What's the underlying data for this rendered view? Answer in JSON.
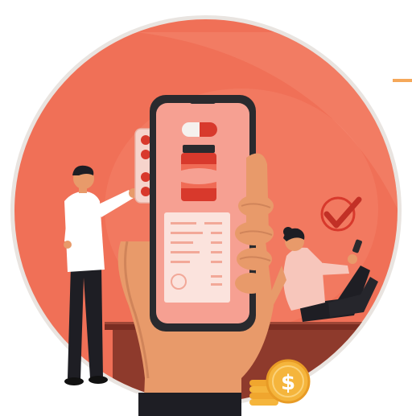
{
  "illustration": {
    "theme": "online pharmacy / mobile medicine ordering",
    "coin_symbol": "$",
    "colors": {
      "background_circle": "#f07057",
      "circle_border": "#ffffff",
      "phone_frame": "#2a2a2e",
      "phone_screen": "#f6a092",
      "pill_red": "#d8392c",
      "skin": "#e89a6a",
      "coin_gold": "#f5b53c",
      "check_red": "#d8392c"
    },
    "icons": [
      "pill-blister-icon",
      "capsule-icon",
      "medicine-bottle-icon",
      "receipt-icon",
      "checkmark-icon",
      "dollar-coin-icon",
      "smartphone-icon"
    ]
  }
}
